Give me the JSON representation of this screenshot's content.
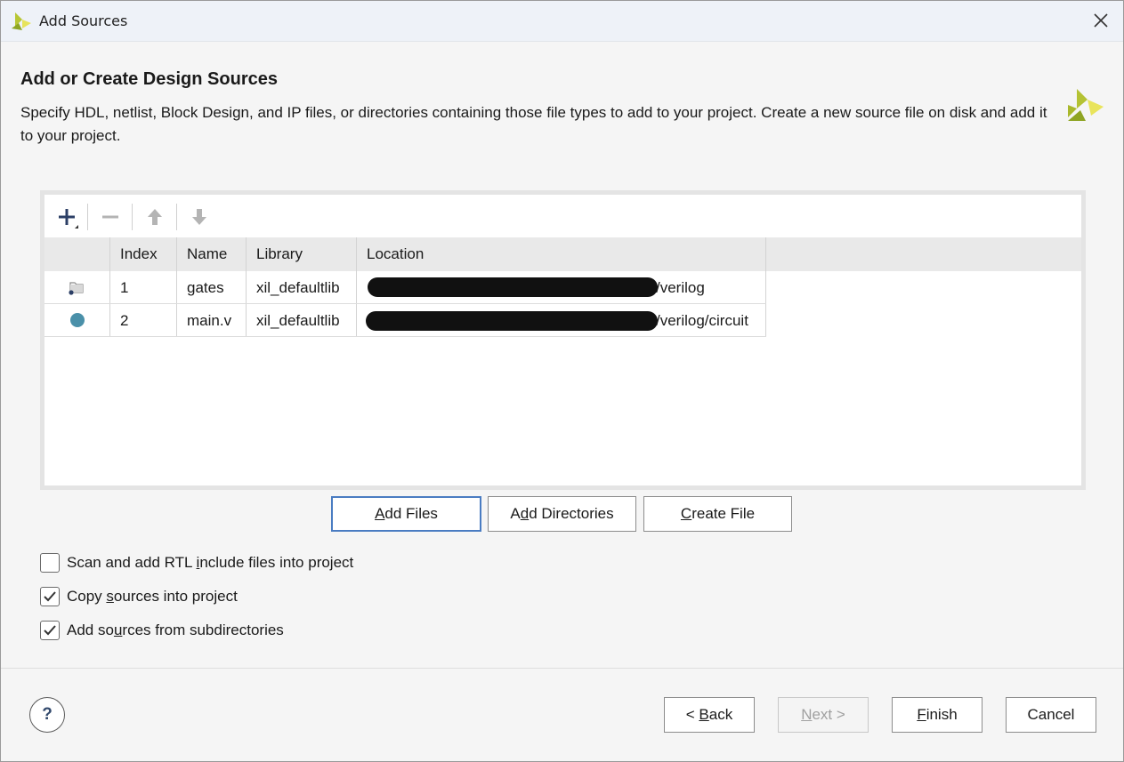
{
  "window": {
    "title": "Add Sources"
  },
  "page": {
    "heading": "Add or Create Design Sources",
    "description": "Specify HDL, netlist, Block Design, and IP files, or directories containing those file types to add to your project. Create a new source file on disk and add it to your project."
  },
  "table": {
    "columns": [
      "Index",
      "Name",
      "Library",
      "Location"
    ],
    "rows": [
      {
        "icon": "folder-icon",
        "index": "1",
        "name": "gates",
        "library": "xil_defaultlib",
        "location_suffix": "/verilog"
      },
      {
        "icon": "file-dot-icon",
        "index": "2",
        "name": "main.v",
        "library": "xil_defaultlib",
        "location_suffix": "/verilog/circuit"
      }
    ]
  },
  "actions": {
    "add_files": {
      "pre": "",
      "u": "A",
      "post": "dd Files"
    },
    "add_directories": {
      "pre": "A",
      "u": "d",
      "post": "d Directories"
    },
    "create_file": {
      "pre": "",
      "u": "C",
      "post": "reate File"
    }
  },
  "options": [
    {
      "pre": "Scan and add RTL ",
      "u": "i",
      "post": "nclude files into project",
      "checked": false
    },
    {
      "pre": "Copy ",
      "u": "s",
      "post": "ources into project",
      "checked": true
    },
    {
      "pre": "Add so",
      "u": "u",
      "post": "rces from subdirectories",
      "checked": true
    }
  ],
  "footer": {
    "help": "?",
    "back": {
      "pre": "< ",
      "u": "B",
      "post": "ack"
    },
    "next": {
      "pre": "",
      "u": "N",
      "post": "ext >"
    },
    "finish": {
      "pre": "",
      "u": "F",
      "post": "inish"
    },
    "cancel": "Cancel"
  },
  "colors": {
    "accent": "#4a7cc2",
    "brand_green": "#9ab52d",
    "brand_yellow": "#e5e04a"
  }
}
